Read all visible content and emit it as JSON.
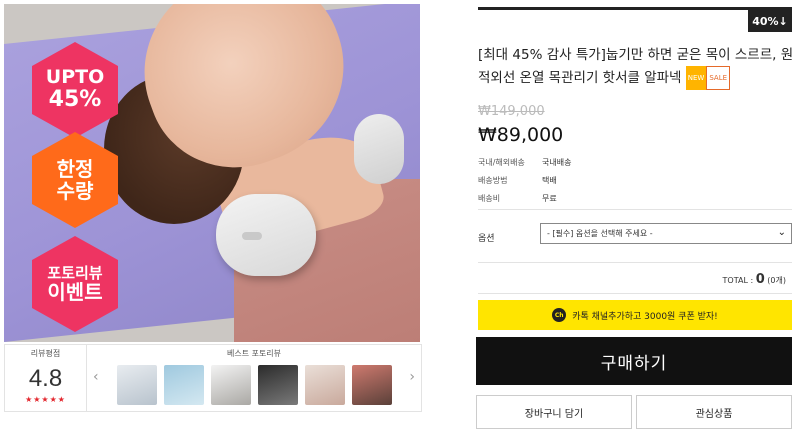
{
  "image": {
    "badges": [
      {
        "line1": "UPTO",
        "line2": "45%"
      },
      {
        "line1": "한정",
        "line2": "수량"
      },
      {
        "line1": "포토리뷰",
        "line2": "이벤트"
      }
    ]
  },
  "review": {
    "score_caption": "리뷰평점",
    "score": "4.8",
    "stars": "★★★★★",
    "best_caption": "베스트 포토리뷰",
    "thumb_icons": [
      "product-thumb",
      "product-thumb",
      "product-thumb",
      "product-thumb",
      "product-thumb",
      "product-thumb"
    ]
  },
  "product": {
    "discount": "40%↓",
    "title": "[최대 45% 감사 특가]눕기만 하면 굳은 목이 스르르, 원적외선 온열 목관리기 핫서클 알파넥",
    "tag_new": "NEW",
    "tag_sale": "SALE",
    "old_price": "₩149,000",
    "price": "₩89,000",
    "info": [
      {
        "key": "국내/해외배송",
        "value": "국내배송"
      },
      {
        "key": "배송방법",
        "value": "택배"
      },
      {
        "key": "배송비",
        "value": "무료"
      }
    ]
  },
  "options": {
    "label": "옵션",
    "selected": "- [필수] 옵션을 선택해 주세요 -"
  },
  "total": {
    "label": "TOTAL : ",
    "count": "0",
    "unit": " (0개)"
  },
  "buttons": {
    "kakao_icon": "Ch",
    "kakao": "카톡 채널추가하고 3000원 쿠폰 받자!",
    "buy": "구매하기",
    "cart": "장바구니 담기",
    "wish": "관심상품"
  },
  "colors": {
    "accent_pink": "#ee3462",
    "accent_orange": "#ff6a1a",
    "kakao_yellow": "#ffe500",
    "buy_black": "#111111"
  }
}
